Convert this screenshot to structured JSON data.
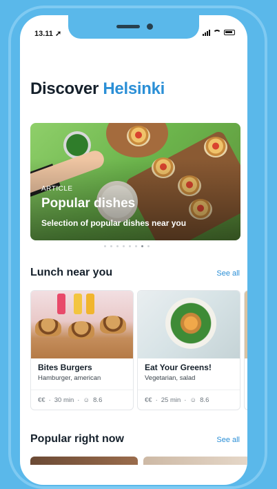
{
  "status_bar": {
    "time": "13.11"
  },
  "header": {
    "title_prefix": "Discover",
    "title_city": "Helsinki"
  },
  "hero": {
    "kicker": "ARTICLE",
    "title": "Popular dishes",
    "subtitle": "Selection of popular dishes near you",
    "pages": 8,
    "active_page": 6
  },
  "lunch": {
    "title": "Lunch near you",
    "see_all": "See all",
    "cards": [
      {
        "name": "Bites Burgers",
        "tags": "Hamburger, american",
        "price": "€€",
        "time": "30 min",
        "rating": "8.6"
      },
      {
        "name": "Eat Your Greens!",
        "tags": "Vegetarian, salad",
        "price": "€€",
        "time": "25 min",
        "rating": "8.6"
      }
    ]
  },
  "popular": {
    "title": "Popular right now",
    "see_all": "See all"
  },
  "colors": {
    "accent": "#2b8fd6",
    "frame": "#5ab8ea",
    "text": "#15202b"
  }
}
